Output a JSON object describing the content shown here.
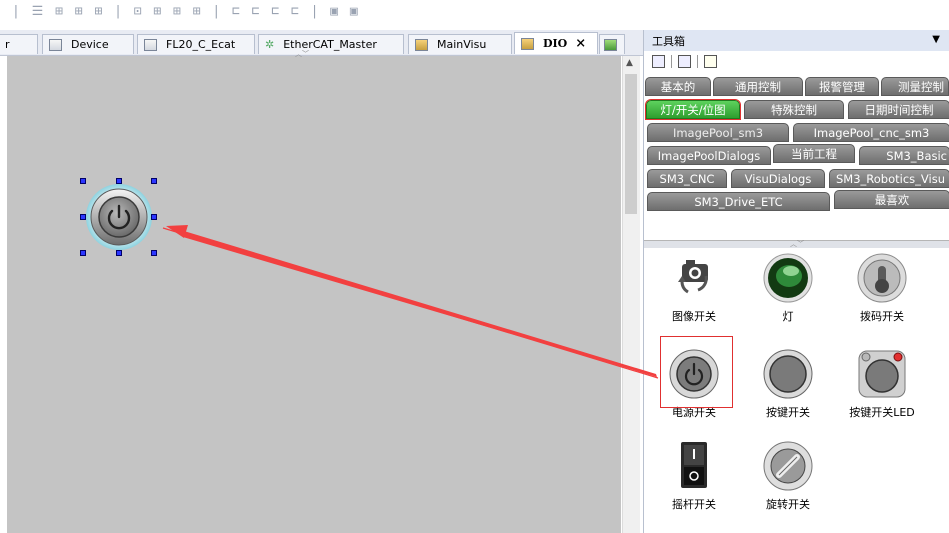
{
  "toolbar": {
    "glyphs": "| ☰ ⊞ ⊞ ⊞ | ⊡ ⊞ ⊞ ⊞ | ⊏ ⊏ ⊏ ⊏ | ▣ ▣"
  },
  "tabs": [
    {
      "label": "r",
      "icon": false
    },
    {
      "label": "Device",
      "icon": "device-icon"
    },
    {
      "label": "FL20_C_Ecat",
      "icon": "device-icon"
    },
    {
      "label": "EtherCAT_Master",
      "icon": "ethercat-icon"
    },
    {
      "label": "MainVisu",
      "icon": "visu-icon"
    },
    {
      "label": "DIO",
      "icon": "visu-icon",
      "active": true,
      "close": "×"
    },
    {
      "label": "",
      "icon": "more-icon"
    }
  ],
  "toolbox": {
    "title": "工具箱",
    "categories_row1": [
      "基本的",
      "通用控制",
      "报警管理",
      "测量控制"
    ],
    "categories_row2": [
      "灯/开关/位图",
      "特殊控制",
      "日期时间控制"
    ],
    "libraries": [
      [
        "ImagePool_sm3",
        "ImagePool_cnc_sm3"
      ],
      [
        "ImagePoolDialogs",
        "当前工程",
        "SM3_Basic"
      ],
      [
        "SM3_CNC",
        "VisuDialogs",
        "SM3_Robotics_Visu"
      ],
      [
        "SM3_Drive_ETC",
        "最喜欢"
      ]
    ],
    "items": [
      {
        "label": "图像开关",
        "icon": "image-switch-icon"
      },
      {
        "label": "灯",
        "icon": "lamp-icon"
      },
      {
        "label": "拨码开关",
        "icon": "dip-switch-icon"
      },
      {
        "label": "电源开关",
        "icon": "power-switch-icon"
      },
      {
        "label": "按键开关",
        "icon": "push-switch-icon"
      },
      {
        "label": "按键开关LED",
        "icon": "push-switch-led-icon"
      },
      {
        "label": "摇杆开关",
        "icon": "rocker-switch-icon"
      },
      {
        "label": "旋转开关",
        "icon": "rotary-switch-icon"
      }
    ]
  },
  "colors": {
    "canvas": "#c4c4c4",
    "selected_category": "#3cb43c",
    "category": "#858585",
    "highlight": "#e03030",
    "arrow": "#f24040"
  }
}
